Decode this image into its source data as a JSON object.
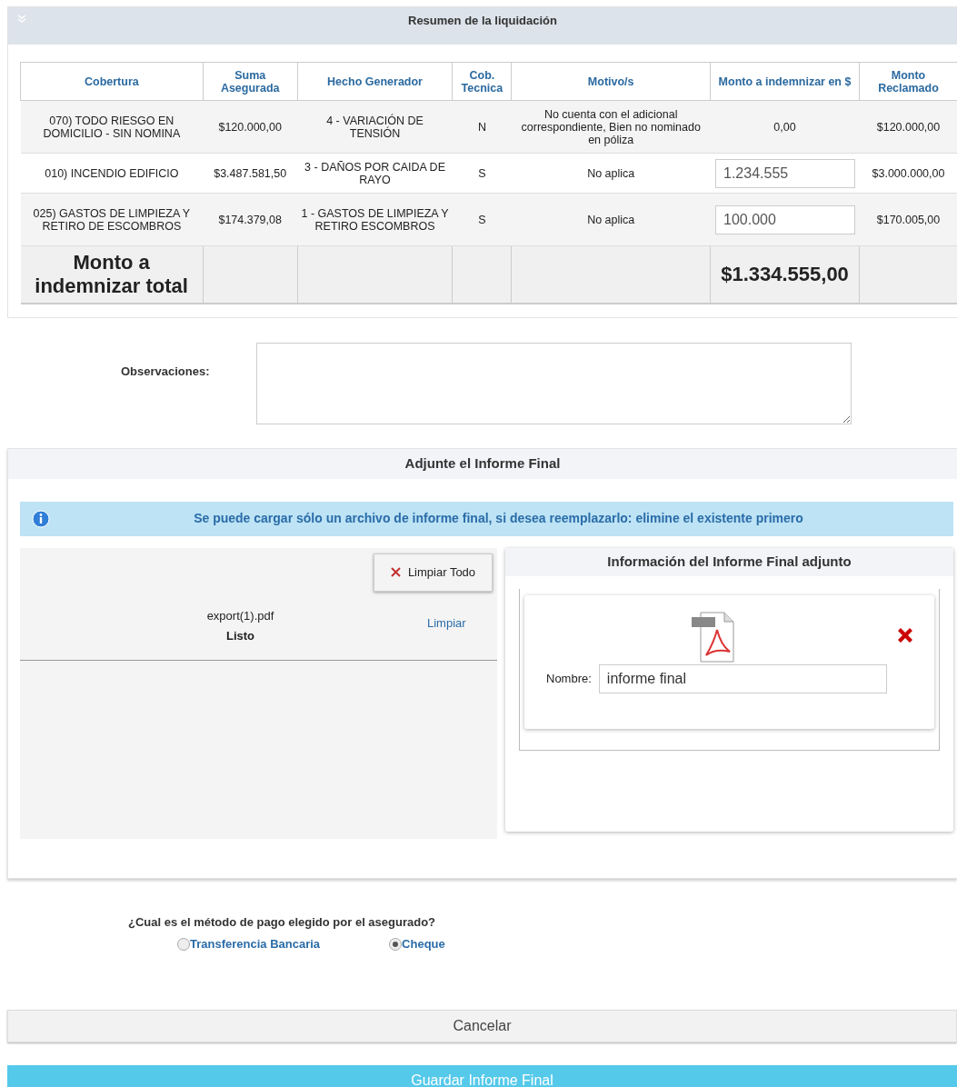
{
  "summary": {
    "title": "Resumen de la liquidación",
    "columns": [
      "Cobertura",
      "Suma Asegurada",
      "Hecho Generador",
      "Cob. Tecnica",
      "Motivo/s",
      "Monto a indemnizar en $",
      "Monto Reclamado"
    ],
    "rows": [
      {
        "cobertura": "070) TODO RIESGO EN DOMICILIO - SIN NOMINA",
        "suma": "$120.000,00",
        "hecho": "4 - VARIACIÓN DE TENSIÓN",
        "cob_tecnica": "N",
        "motivo": "No cuenta con el adicional correspondiente, Bien no nominado en póliza",
        "monto": {
          "kind": "text",
          "value": "0,00"
        },
        "reclamado": "$120.000,00"
      },
      {
        "cobertura": "010) INCENDIO EDIFICIO",
        "suma": "$3.487.581,50",
        "hecho": "3 - DAÑOS POR CAIDA DE RAYO",
        "cob_tecnica": "S",
        "motivo": "No aplica",
        "monto": {
          "kind": "input",
          "value": "1.234.555"
        },
        "reclamado": "$3.000.000,00"
      },
      {
        "cobertura": "025) GASTOS DE LIMPIEZA Y RETIRO DE ESCOMBROS",
        "suma": "$174.379,08",
        "hecho": "1 - GASTOS DE LIMPIEZA Y RETIRO ESCOMBROS",
        "cob_tecnica": "S",
        "motivo": "No aplica",
        "monto": {
          "kind": "input",
          "value": "100.000"
        },
        "reclamado": "$170.005,00"
      }
    ],
    "total": {
      "label": "Monto a indemnizar total",
      "value": "$1.334.555,00"
    }
  },
  "observaciones": {
    "label": "Observaciones:"
  },
  "attach": {
    "title": "Adjunte el Informe Final",
    "info": "Se puede cargar sólo un archivo de informe final, si desea reemplazarlo: elimine el existente primero",
    "clear_all": "Limpiar Todo",
    "files": [
      {
        "name": "export(1).pdf",
        "status": "Listo",
        "action": "Limpiar"
      }
    ],
    "info_panel": {
      "title": "Información del Informe Final adjunto",
      "name_label": "Nombre:",
      "name_value": "informe final"
    }
  },
  "payment": {
    "question": "¿Cual es el método de pago elegido por el asegurado?",
    "options": [
      {
        "label": "Transferencia Bancaria",
        "selected": false
      },
      {
        "label": "Cheque",
        "selected": true
      }
    ]
  },
  "buttons": {
    "cancel": "Cancelar",
    "save": "Guardar Informe Final"
  }
}
